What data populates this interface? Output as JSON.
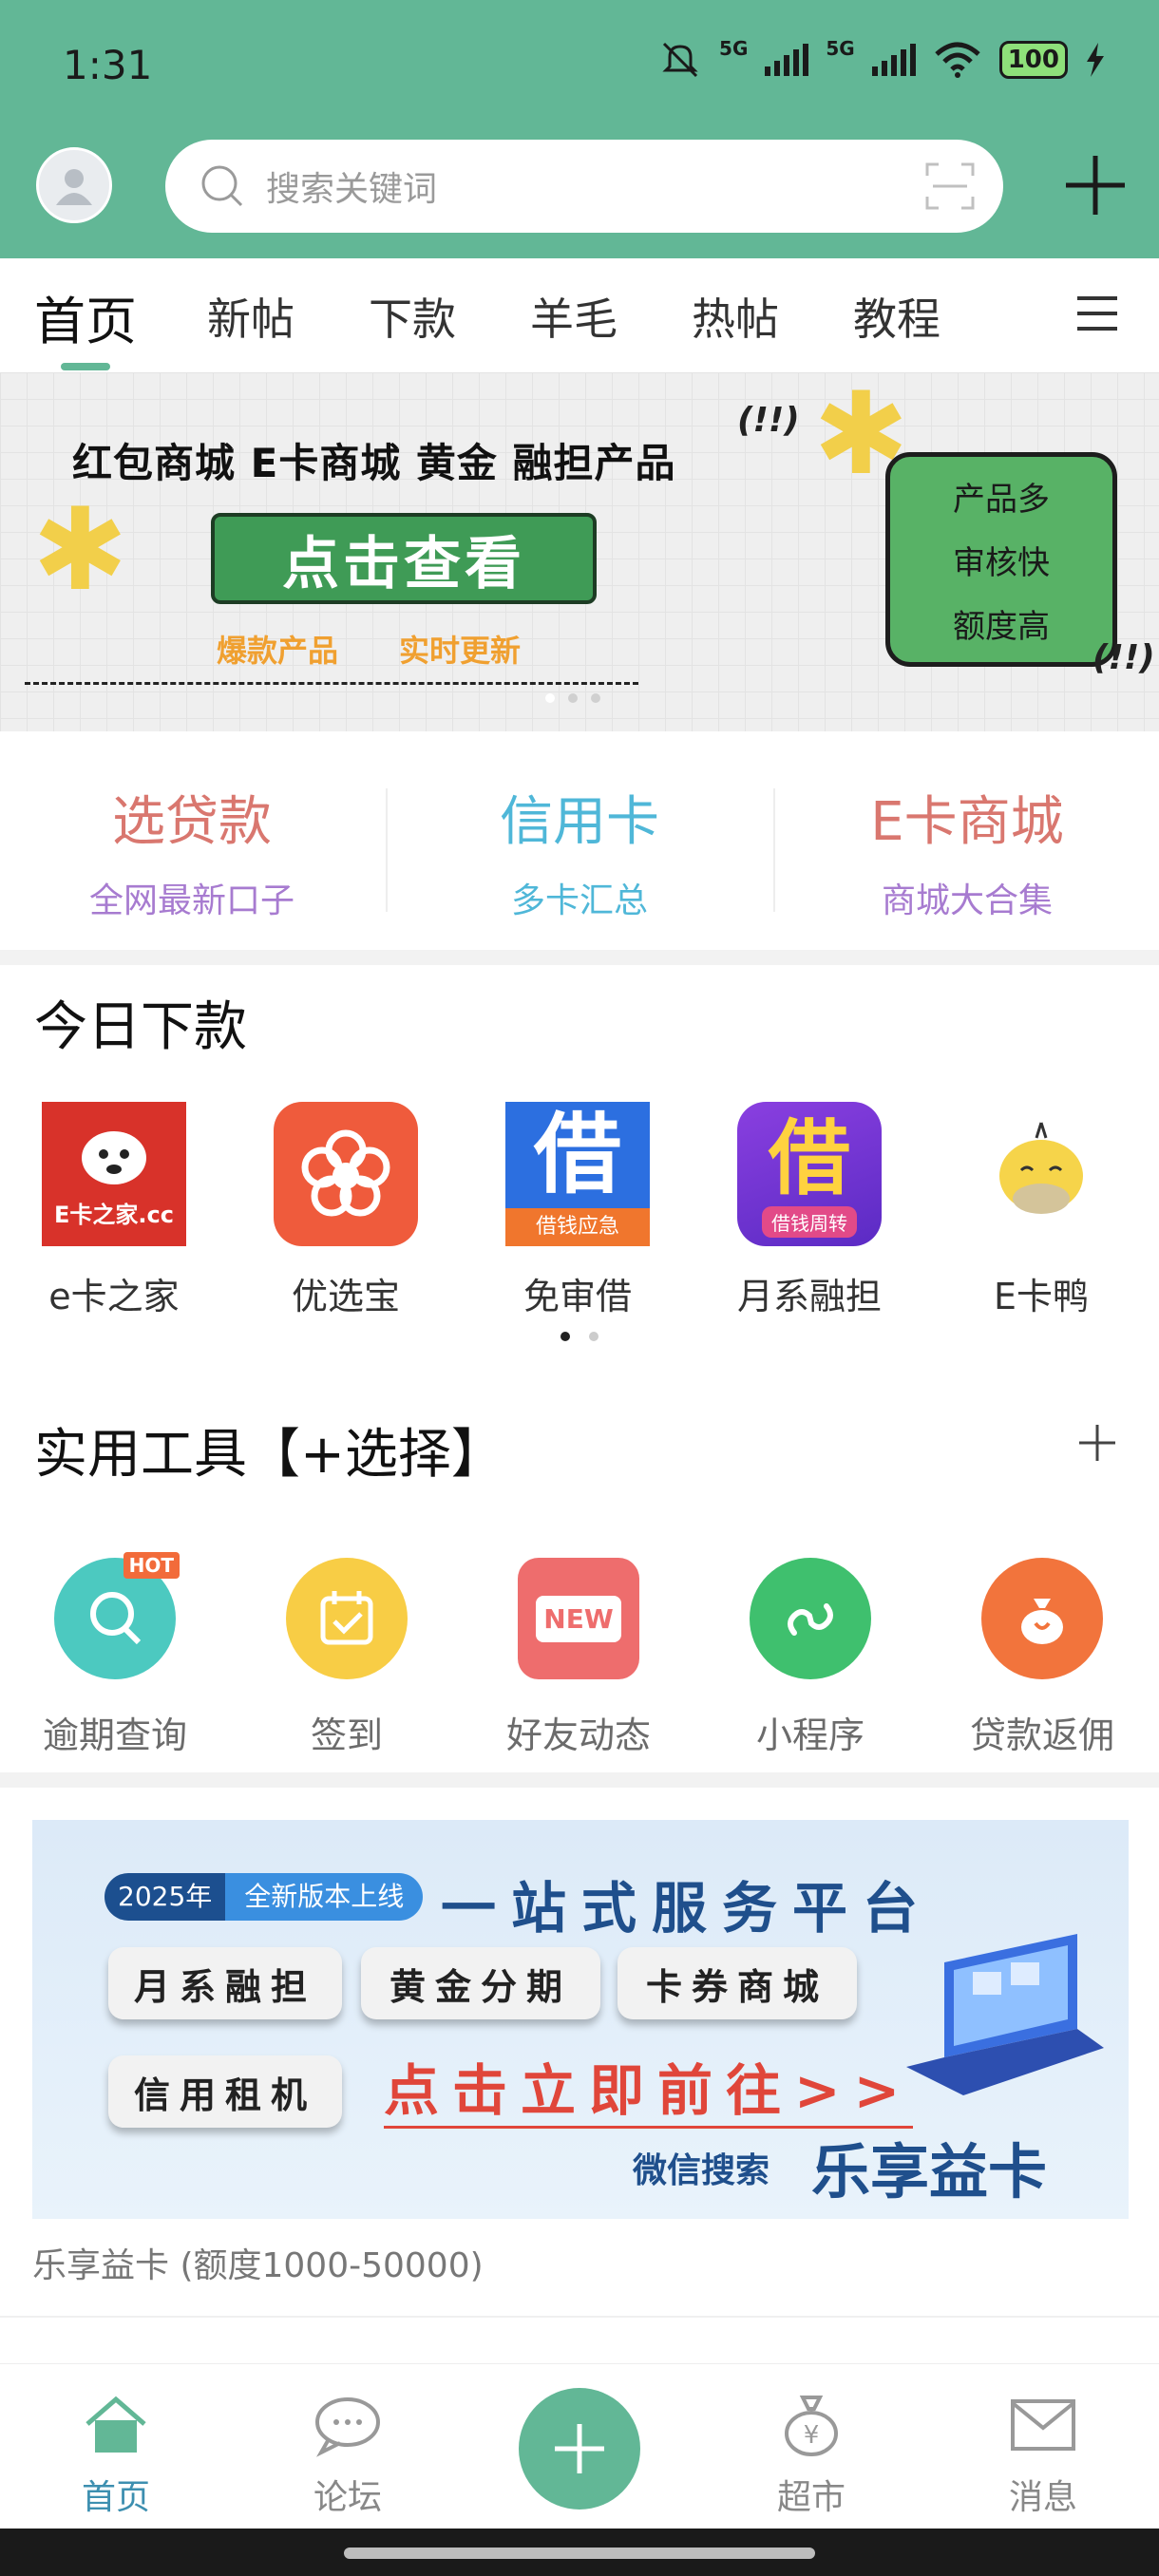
{
  "status_bar": {
    "time": "1:31",
    "signal1": "5G",
    "signal2": "5G",
    "battery": "100"
  },
  "header": {
    "search_placeholder": "搜索关键词"
  },
  "tabs": [
    "首页",
    "新帖",
    "下款",
    "羊毛",
    "热帖",
    "教程"
  ],
  "banner": {
    "headline": "红包商城  E卡商城  黄金  融担产品",
    "button": "点击查看",
    "sub1": "爆款产品",
    "sub2": "实时更新",
    "exclaim": "(!!)",
    "card": [
      "产品多",
      "审核快",
      "额度高"
    ]
  },
  "quick_links": [
    {
      "title": "选贷款",
      "sub": "全网最新口子"
    },
    {
      "title": "信用卡",
      "sub": "多卡汇总"
    },
    {
      "title": "E卡商城",
      "sub": "商城大合集"
    }
  ],
  "today": {
    "title": "今日下款",
    "apps": [
      {
        "label": "e卡之家",
        "icon_text": "E卡之家.cc"
      },
      {
        "label": "优选宝",
        "icon_text": ""
      },
      {
        "label": "免审借",
        "icon_text": "借",
        "icon_sub": "借钱应急"
      },
      {
        "label": "月系融担",
        "icon_text": "借",
        "icon_sub": "借钱周转"
      },
      {
        "label": "E卡鸭",
        "icon_text": ""
      }
    ]
  },
  "tools": {
    "title": "实用工具【+选择】",
    "hot_badge": "HOT",
    "new_badge": "NEW",
    "items": [
      {
        "label": "逾期查询",
        "icon": "magnifier-icon"
      },
      {
        "label": "签到",
        "icon": "calendar-check-icon"
      },
      {
        "label": "好友动态",
        "icon": "new-tag-icon"
      },
      {
        "label": "小程序",
        "icon": "mini-program-icon"
      },
      {
        "label": "贷款返佣",
        "icon": "money-bag-icon"
      }
    ]
  },
  "ad": {
    "tag_year": "2025年",
    "tag_text": "全新版本上线",
    "headline": "一站式服务平台",
    "pills": [
      "月系融担",
      "黄金分期",
      "卡券商城",
      "信用租机"
    ],
    "cta": "点击立即前往>>",
    "wx": "微信搜索",
    "brand": "乐享益卡",
    "caption": "乐享益卡 (额度1000-50000)"
  },
  "bottom_nav": [
    {
      "label": "首页",
      "icon": "home-icon",
      "active": true
    },
    {
      "label": "论坛",
      "icon": "chat-bubble-icon",
      "active": false
    },
    {
      "label": "超市",
      "icon": "money-bag-icon",
      "active": false
    },
    {
      "label": "消息",
      "icon": "envelope-icon",
      "active": false
    }
  ],
  "colors": {
    "brand_green": "#62b796",
    "quick1": "#d9776f",
    "quick1_sub": "#a77bd0",
    "quick2": "#4fb7d8",
    "quick2_sub": "#4fb7d8",
    "quick3": "#d9776f",
    "quick3_sub": "#a77bd0"
  }
}
